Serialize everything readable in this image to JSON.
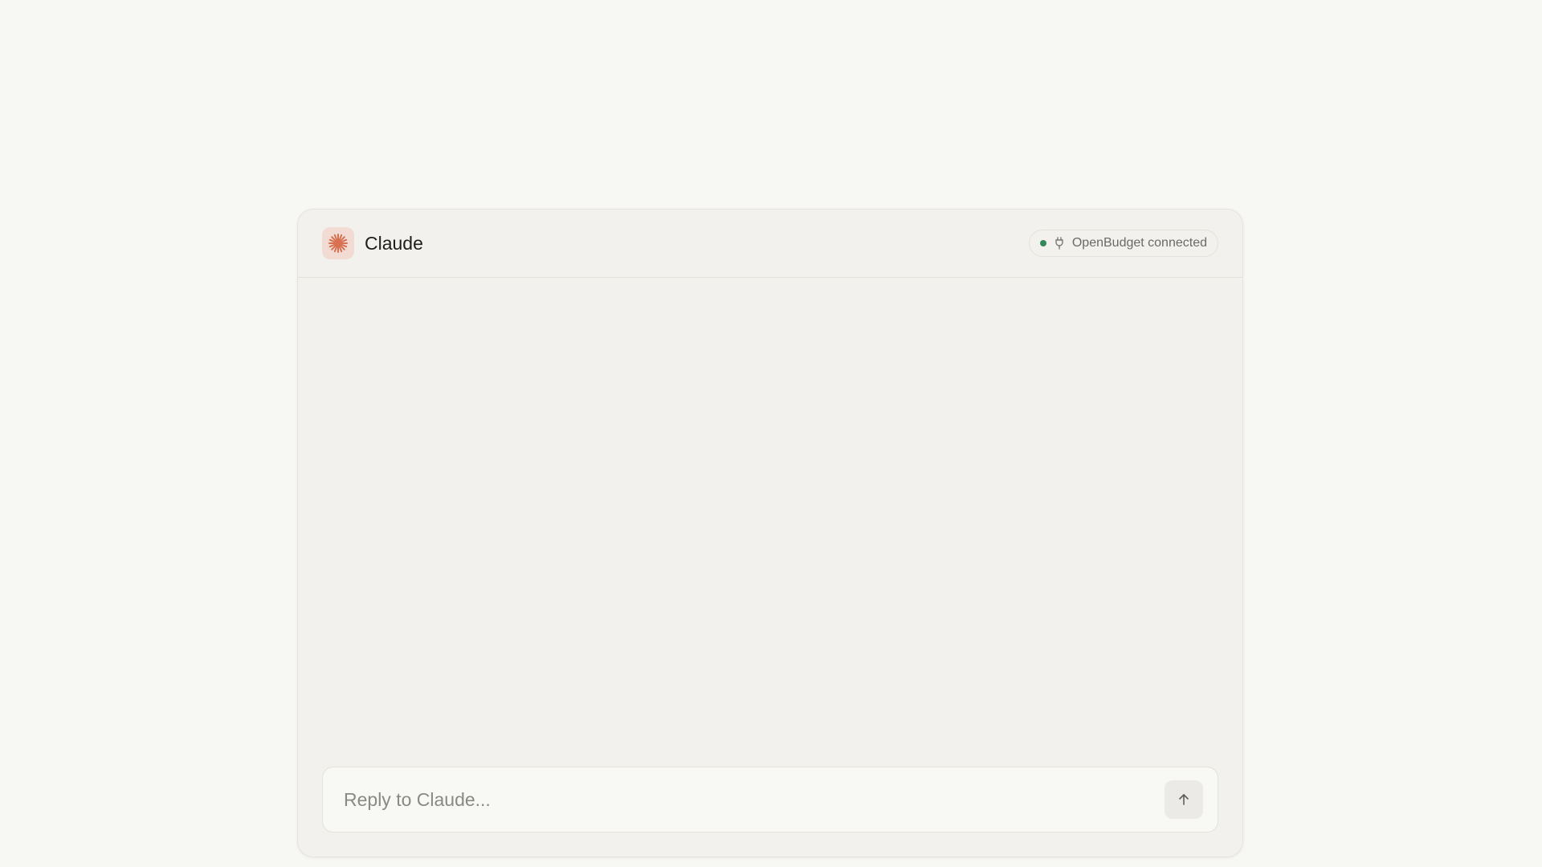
{
  "app": {
    "title": "Claude",
    "logo_icon": "claude-starburst-icon",
    "accent_color": "#d9704f"
  },
  "connection": {
    "label": "OpenBudget connected",
    "status_color": "#2e8b57",
    "icon": "plug-icon"
  },
  "composer": {
    "placeholder": "Reply to Claude...",
    "value": "",
    "send_icon": "arrow-up-icon"
  }
}
